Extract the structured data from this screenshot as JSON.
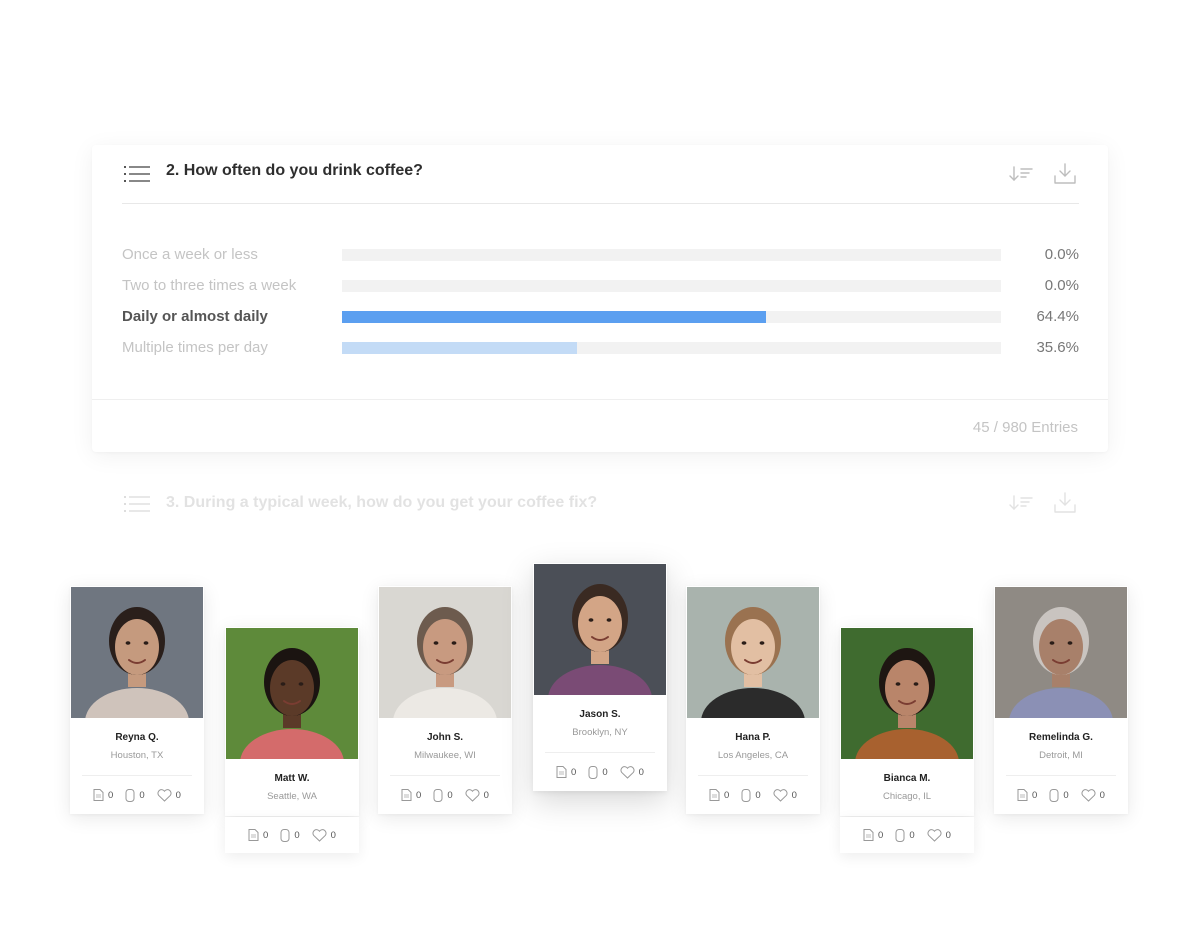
{
  "question": {
    "title": "2. How often do you drink coffee?",
    "icons": {
      "list": "list-icon",
      "sort": "sort-icon",
      "download": "download-icon"
    },
    "options": [
      {
        "label": "Once a week or less",
        "percent_text": "0.0%",
        "value": 0.0,
        "active": false
      },
      {
        "label": "Two to three times a week",
        "percent_text": "0.0%",
        "value": 0.0,
        "active": false
      },
      {
        "label": "Daily or almost daily",
        "percent_text": "64.4%",
        "value": 64.4,
        "active": true
      },
      {
        "label": "Multiple times per day",
        "percent_text": "35.6%",
        "value": 35.6,
        "active": false
      }
    ],
    "entries": "45 / 980 Entries",
    "colors": {
      "active_bar": "#5b9ff0",
      "secondary_bar": "#c3dbf6",
      "track": "#f2f2f2"
    }
  },
  "next_question": {
    "title": "3. During a typical week, how do you get your coffee fix?"
  },
  "people": [
    {
      "name": "Reyna Q.",
      "location": "Houston, TX",
      "docs": "0",
      "clips": "0",
      "likes": "0"
    },
    {
      "name": "Matt W.",
      "location": "Seattle, WA",
      "docs": "0",
      "clips": "0",
      "likes": "0"
    },
    {
      "name": "John S.",
      "location": "Milwaukee, WI",
      "docs": "0",
      "clips": "0",
      "likes": "0"
    },
    {
      "name": "Jason S.",
      "location": "Brooklyn, NY",
      "docs": "0",
      "clips": "0",
      "likes": "0"
    },
    {
      "name": "Hana P.",
      "location": "Los Angeles, CA",
      "docs": "0",
      "clips": "0",
      "likes": "0"
    },
    {
      "name": "Bianca M.",
      "location": "Chicago, IL",
      "docs": "0",
      "clips": "0",
      "likes": "0"
    },
    {
      "name": "Remelinda G.",
      "location": "Detroit, MI",
      "docs": "0",
      "clips": "0",
      "likes": "0"
    }
  ]
}
